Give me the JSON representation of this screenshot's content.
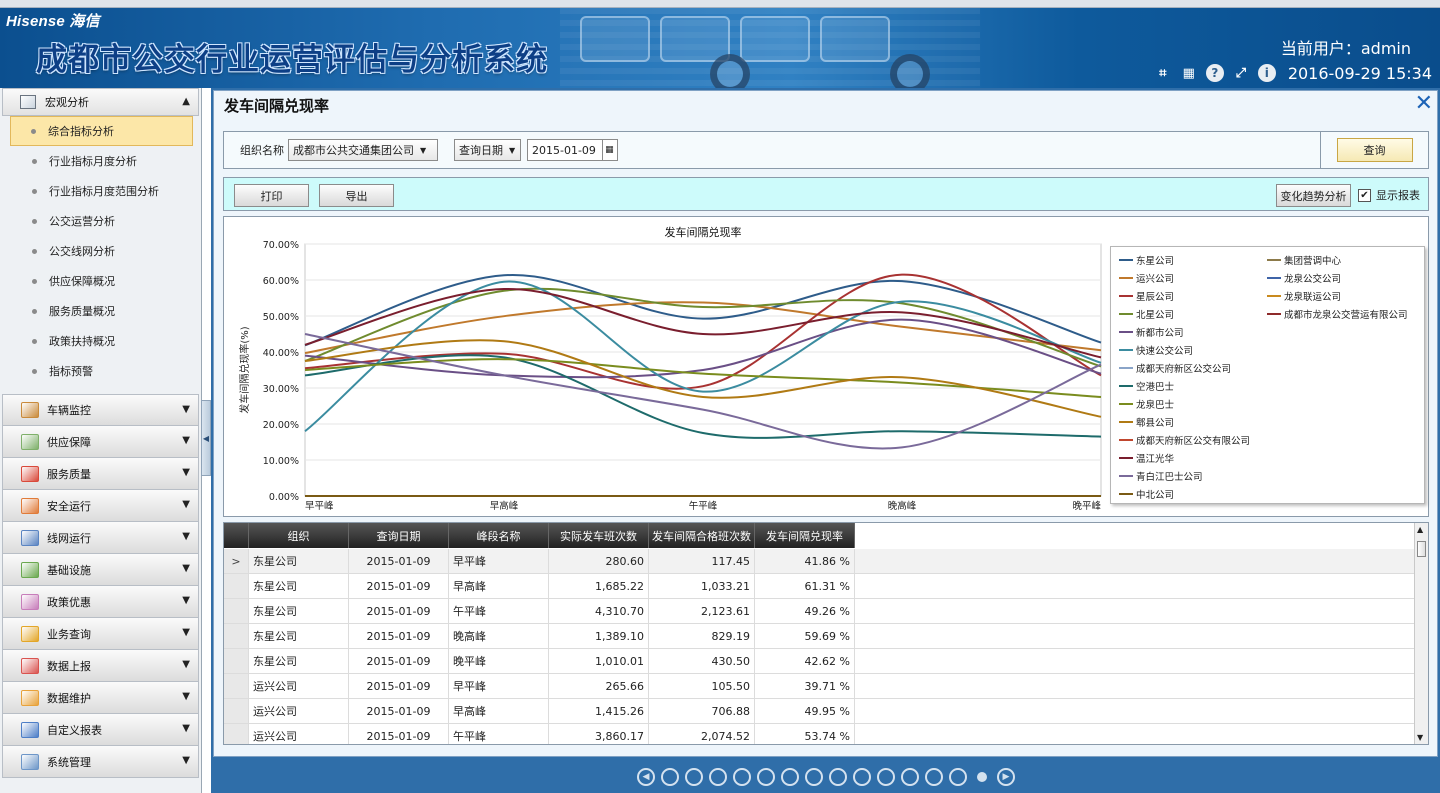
{
  "header": {
    "logo": "Hisense 海信",
    "title": "成都市公交行业运营评估与分析系统",
    "current_user": "当前用户：admin",
    "datetime": "2016-09-29 15:34"
  },
  "sidebar": {
    "open_group": "宏观分析",
    "subitems": [
      "综合指标分析",
      "行业指标月度分析",
      "行业指标月度范围分析",
      "公交运营分析",
      "公交线网分析",
      "供应保障概况",
      "服务质量概况",
      "政策扶持概况",
      "指标预警"
    ],
    "active_index": 0,
    "groups": [
      {
        "label": "车辆监控",
        "color": "#c98a3b"
      },
      {
        "label": "供应保障",
        "color": "#7fb06a"
      },
      {
        "label": "服务质量",
        "color": "#d9493a"
      },
      {
        "label": "安全运行",
        "color": "#e07b39"
      },
      {
        "label": "线网运行",
        "color": "#5a84c2"
      },
      {
        "label": "基础设施",
        "color": "#6aa84f"
      },
      {
        "label": "政策优惠",
        "color": "#c77dba"
      },
      {
        "label": "业务查询",
        "color": "#e3a628"
      },
      {
        "label": "数据上报",
        "color": "#d9534f"
      },
      {
        "label": "数据维护",
        "color": "#e8a23a"
      },
      {
        "label": "自定义报表",
        "color": "#4d7ec7"
      },
      {
        "label": "系统管理",
        "color": "#6d96c8"
      }
    ]
  },
  "panel": {
    "title": "发车间隔兑现率",
    "filters": {
      "org_label": "组织名称",
      "org_value": "成都市公共交通集团公司",
      "date_type": "查询日期",
      "date_value": "2015-01-09",
      "query_label": "查询"
    },
    "toolbar": {
      "print_label": "打印",
      "export_label": "导出",
      "trend_label": "变化趋势分析",
      "show_report_label": "显示报表",
      "show_report_checked": true
    }
  },
  "chart_data": {
    "type": "line",
    "title": "发车间隔兑现率",
    "ylabel": "发车间隔兑现率(%)",
    "xlabel": "",
    "categories": [
      "早平峰",
      "早高峰",
      "午平峰",
      "晚高峰",
      "晚平峰"
    ],
    "ylim": [
      0,
      70
    ],
    "yticks": [
      "0.00%",
      "10.00%",
      "20.00%",
      "30.00%",
      "40.00%",
      "50.00%",
      "60.00%",
      "70.00%"
    ],
    "legend": "right",
    "series": [
      {
        "name": "东星公司",
        "color": "#2e5c8a",
        "values": [
          41.86,
          61.31,
          49.26,
          59.69,
          42.62
        ]
      },
      {
        "name": "集团营调中心",
        "color": "#8c7a4a",
        "values": [
          0,
          0,
          0,
          0,
          0
        ]
      },
      {
        "name": "运兴公司",
        "color": "#c0792c",
        "values": [
          39.71,
          49.95,
          53.74,
          47.0,
          40.5
        ]
      },
      {
        "name": "龙泉公交公司",
        "color": "#3f64a8",
        "values": [
          0,
          0,
          0,
          0,
          0
        ]
      },
      {
        "name": "星辰公司",
        "color": "#a83232",
        "values": [
          35.5,
          39.5,
          30.5,
          61.5,
          33.5
        ]
      },
      {
        "name": "龙泉联运公司",
        "color": "#c98a1e",
        "values": [
          0,
          0,
          0,
          0,
          0
        ]
      },
      {
        "name": "北星公司",
        "color": "#6f8b2e",
        "values": [
          37.5,
          57.0,
          52.5,
          53.5,
          36.0
        ]
      },
      {
        "name": "成都市龙泉公交营运有限公司",
        "color": "#8e2a2a",
        "values": [
          0,
          0,
          0,
          0,
          0
        ]
      },
      {
        "name": "新都市公司",
        "color": "#6a4f86",
        "values": [
          39.0,
          33.5,
          35.0,
          49.0,
          34.0
        ]
      },
      {
        "name": "快速公交公司",
        "color": "#3b8ca0",
        "values": [
          18.0,
          59.5,
          29.0,
          54.0,
          37.0
        ]
      },
      {
        "name": "成都天府新区公交公司",
        "color": "#8aa4c8",
        "values": [
          0,
          0,
          0,
          0,
          0
        ]
      },
      {
        "name": "空港巴士",
        "color": "#1e6b6b",
        "values": [
          33.5,
          38.5,
          17.5,
          18.0,
          16.5
        ]
      },
      {
        "name": "龙泉巴士",
        "color": "#7a8c1e",
        "values": [
          35.0,
          38.0,
          34.0,
          31.5,
          27.5
        ]
      },
      {
        "name": "郫县公司",
        "color": "#b07a14",
        "values": [
          37.5,
          43.0,
          27.5,
          33.0,
          22.0
        ]
      },
      {
        "name": "成都天府新区公交有限公司",
        "color": "#c0462e",
        "values": [
          0,
          0,
          0,
          0,
          0
        ]
      },
      {
        "name": "温江光华",
        "color": "#7a1e2e",
        "values": [
          42.0,
          57.5,
          45.0,
          51.0,
          38.5
        ]
      },
      {
        "name": "青白江巴士公司",
        "color": "#7a6a9a",
        "values": [
          45.0,
          33.5,
          24.0,
          13.5,
          36.5
        ]
      },
      {
        "name": "中北公司",
        "color": "#7a5a14",
        "values": [
          0,
          0,
          0,
          0,
          0
        ]
      }
    ]
  },
  "grid": {
    "columns": [
      "组织",
      "查询日期",
      "峰段名称",
      "实际发车班次数",
      "发车间隔合格班次数",
      "发车间隔兑现率"
    ],
    "rows": [
      [
        "东星公司",
        "2015-01-09",
        "早平峰",
        "280.60",
        "117.45",
        "41.86 %"
      ],
      [
        "东星公司",
        "2015-01-09",
        "早高峰",
        "1,685.22",
        "1,033.21",
        "61.31 %"
      ],
      [
        "东星公司",
        "2015-01-09",
        "午平峰",
        "4,310.70",
        "2,123.61",
        "49.26 %"
      ],
      [
        "东星公司",
        "2015-01-09",
        "晚高峰",
        "1,389.10",
        "829.19",
        "59.69 %"
      ],
      [
        "东星公司",
        "2015-01-09",
        "晚平峰",
        "1,010.01",
        "430.50",
        "42.62 %"
      ],
      [
        "运兴公司",
        "2015-01-09",
        "早平峰",
        "265.66",
        "105.50",
        "39.71 %"
      ],
      [
        "运兴公司",
        "2015-01-09",
        "早高峰",
        "1,415.26",
        "706.88",
        "49.95 %"
      ],
      [
        "运兴公司",
        "2015-01-09",
        "午平峰",
        "3,860.17",
        "2,074.52",
        "53.74 %"
      ]
    ],
    "selected_row": 0,
    "row_indicator": ">"
  },
  "pager": {
    "pages": 14,
    "current": 14
  }
}
